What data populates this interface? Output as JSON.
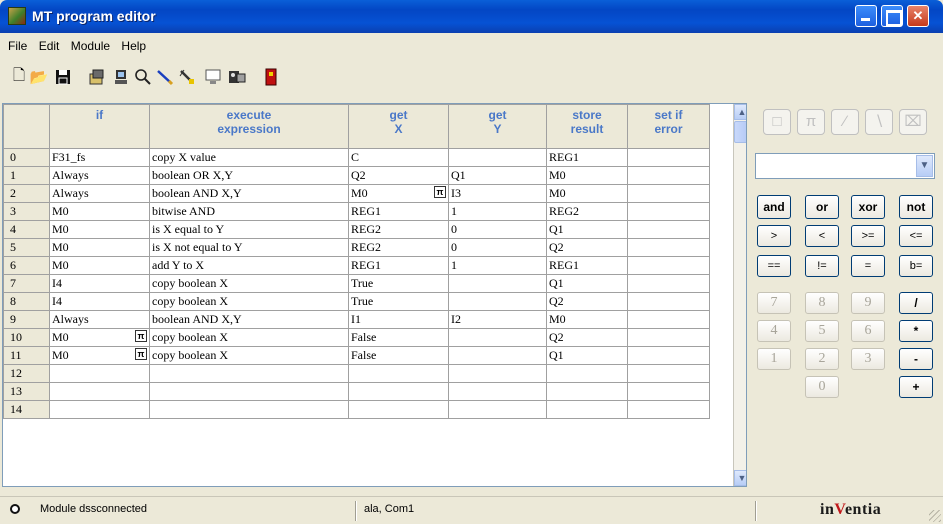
{
  "window": {
    "title": "MT program editor"
  },
  "menu": [
    "File",
    "Edit",
    "Module",
    "Help"
  ],
  "toolbar": {
    "icons": [
      "new-file-icon",
      "open-folder-icon",
      "save-icon",
      "upload-icon",
      "download-icon",
      "search-icon",
      "pencil-icon",
      "wand-icon",
      "monitor-icon",
      "module-icon",
      "stop-icon"
    ]
  },
  "grid": {
    "headers": [
      {
        "line1": "",
        "line2": ""
      },
      {
        "line1": "if",
        "line2": ""
      },
      {
        "line1": "execute",
        "line2": "expression"
      },
      {
        "line1": "get",
        "line2": "X"
      },
      {
        "line1": "get",
        "line2": "Y"
      },
      {
        "line1": "store",
        "line2": "result"
      },
      {
        "line1": "set if",
        "line2": "error"
      }
    ],
    "rows": [
      {
        "n": "0",
        "if": "F31_fs",
        "if_pin": false,
        "expr": "copy X value",
        "x": "C",
        "x_pin": false,
        "y": "",
        "store": "REG1",
        "err": ""
      },
      {
        "n": "1",
        "if": "Always",
        "if_pin": false,
        "expr": "boolean OR X,Y",
        "x": "Q2",
        "x_pin": false,
        "y": "Q1",
        "store": "M0",
        "err": ""
      },
      {
        "n": "2",
        "if": "Always",
        "if_pin": false,
        "expr": "boolean AND X,Y",
        "x": "M0",
        "x_pin": true,
        "y": "I3",
        "store": "M0",
        "err": ""
      },
      {
        "n": "3",
        "if": "M0",
        "if_pin": false,
        "expr": "bitwise AND",
        "x": "REG1",
        "x_pin": false,
        "y": "1",
        "store": "REG2",
        "err": ""
      },
      {
        "n": "4",
        "if": "M0",
        "if_pin": false,
        "expr": "is X equal to Y",
        "x": "REG2",
        "x_pin": false,
        "y": "0",
        "store": "Q1",
        "err": ""
      },
      {
        "n": "5",
        "if": "M0",
        "if_pin": false,
        "expr": "is X not equal to Y",
        "x": "REG2",
        "x_pin": false,
        "y": "0",
        "store": "Q2",
        "err": ""
      },
      {
        "n": "6",
        "if": "M0",
        "if_pin": false,
        "expr": "add Y to X",
        "x": "REG1",
        "x_pin": false,
        "y": "1",
        "store": "REG1",
        "err": ""
      },
      {
        "n": "7",
        "if": "I4",
        "if_pin": false,
        "expr": "copy boolean X",
        "x": "True",
        "x_pin": false,
        "y": "",
        "store": "Q1",
        "err": ""
      },
      {
        "n": "8",
        "if": "I4",
        "if_pin": false,
        "expr": "copy boolean X",
        "x": "True",
        "x_pin": false,
        "y": "",
        "store": "Q2",
        "err": ""
      },
      {
        "n": "9",
        "if": "Always",
        "if_pin": false,
        "expr": "boolean AND X,Y",
        "x": "I1",
        "x_pin": false,
        "y": "I2",
        "store": "M0",
        "err": ""
      },
      {
        "n": "10",
        "if": "M0",
        "if_pin": true,
        "expr": "copy boolean X",
        "x": "False",
        "x_pin": false,
        "y": "",
        "store": "Q2",
        "err": ""
      },
      {
        "n": "11",
        "if": "M0",
        "if_pin": true,
        "expr": "copy boolean X",
        "x": "False",
        "x_pin": false,
        "y": "",
        "store": "Q1",
        "err": ""
      },
      {
        "n": "12",
        "if": "",
        "if_pin": false,
        "expr": "",
        "x": "",
        "x_pin": false,
        "y": "",
        "store": "",
        "err": ""
      },
      {
        "n": "13",
        "if": "",
        "if_pin": false,
        "expr": "",
        "x": "",
        "x_pin": false,
        "y": "",
        "store": "",
        "err": ""
      },
      {
        "n": "14",
        "if": "",
        "if_pin": false,
        "expr": "",
        "x": "",
        "x_pin": false,
        "y": "",
        "store": "",
        "err": ""
      }
    ],
    "pin_glyph": "π",
    "header_color": "#4a78c8"
  },
  "right_panel": {
    "shape_buttons": [
      "□",
      "π",
      "∕",
      "∖",
      "⌧"
    ],
    "combo_value": "",
    "op_rows": [
      [
        "and",
        "or",
        "xor",
        "not"
      ],
      [
        ">",
        "<",
        ">=",
        "<="
      ],
      [
        "==",
        "!=",
        "=",
        "b="
      ]
    ],
    "num_rows": [
      [
        "7",
        "8",
        "9",
        "/"
      ],
      [
        "4",
        "5",
        "6",
        "*"
      ],
      [
        "1",
        "2",
        "3",
        "-"
      ],
      [
        "",
        "0",
        "",
        "+"
      ]
    ]
  },
  "status": {
    "connection_icon": "status-dot-icon",
    "message": "Module dssconnected",
    "port": "ala, Com1",
    "logo_prefix": "in",
    "logo_accent": "V",
    "logo_suffix": "entia",
    "logo_color": "#c0181a"
  }
}
